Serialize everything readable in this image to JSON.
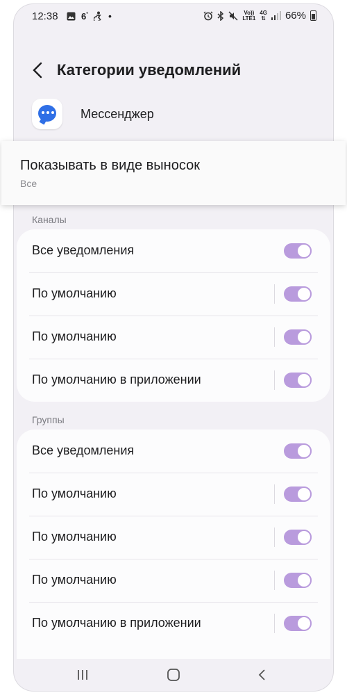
{
  "status_bar": {
    "time": "12:38",
    "left_icons": [
      "image-icon",
      "weather-6-icon",
      "accessibility-icon",
      "dot-icon"
    ],
    "weather_number": "6",
    "right_icons": [
      "alarm-icon",
      "bluetooth-icon",
      "mute-icon",
      "volte-icon",
      "4g-icon",
      "signal-icon",
      "battery-icon"
    ],
    "volte_label_top": "Vo))",
    "volte_label_bottom": "LTE1",
    "network_label": "4G",
    "battery_percent": "66%"
  },
  "header": {
    "title": "Категории уведомлений"
  },
  "app": {
    "name": "Мессенджер",
    "icon": "messenger-icon",
    "accent": "#2f6fe6"
  },
  "bubble_setting": {
    "title": "Показывать в виде выносок",
    "value": "Все"
  },
  "channels": {
    "label": "Каналы",
    "items": [
      {
        "label": "Все уведомления",
        "enabled": true,
        "divider": false
      },
      {
        "label": "По умолчанию",
        "enabled": true,
        "divider": true
      },
      {
        "label": "По умолчанию",
        "enabled": true,
        "divider": true
      },
      {
        "label": "По умолчанию в приложении",
        "enabled": true,
        "divider": true
      }
    ]
  },
  "groups": {
    "label": "Группы",
    "items": [
      {
        "label": "Все уведомления",
        "enabled": true,
        "divider": false
      },
      {
        "label": "По умолчанию",
        "enabled": true,
        "divider": true
      },
      {
        "label": "По умолчанию",
        "enabled": true,
        "divider": true
      },
      {
        "label": "По умолчанию",
        "enabled": true,
        "divider": true
      },
      {
        "label": "По умолчанию в приложении",
        "enabled": true,
        "divider": true
      }
    ]
  },
  "navbar": {
    "buttons": [
      "recents-icon",
      "home-icon",
      "back-icon"
    ]
  },
  "colors": {
    "background": "#f2f0f5",
    "toggle_on": "#b99bdd",
    "card": "#fcfcfd"
  }
}
